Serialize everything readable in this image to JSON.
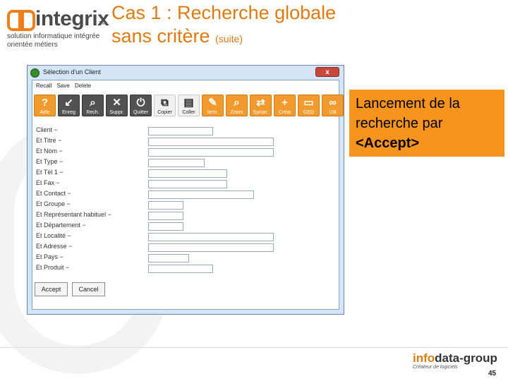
{
  "logo": {
    "word": "integrix",
    "tm": "TM",
    "tagline_1": "solution informatique intégrée",
    "tagline_2": "orientée métiers"
  },
  "slide": {
    "title_line1": "Cas 1 : Recherche globale",
    "title_line2": "sans critère",
    "title_suffix": "(suite)",
    "callout": {
      "line1": "Lancement de la",
      "line2": "recherche par",
      "line3": "<Accept>",
      "color": "#f7941d"
    },
    "page_number": "45",
    "brand": {
      "prefix": "info",
      "name": "data-group",
      "tagline": "Créateur de logiciels"
    }
  },
  "window": {
    "title": "Sélection d'un Client",
    "close": "x",
    "menu": [
      "Recall",
      "Save",
      "Delete"
    ],
    "toolbar": [
      {
        "label": "Aide",
        "glyph": "?",
        "style": "orange"
      },
      {
        "label": "Enreg",
        "glyph": "↙",
        "style": "dark"
      },
      {
        "label": "Rech.",
        "glyph": "⌕",
        "style": "dark"
      },
      {
        "label": "Suppr.",
        "glyph": "✕",
        "style": "dark"
      },
      {
        "label": "Quitter",
        "glyph": "⏻",
        "style": "dark"
      },
      {
        "label": "Copier",
        "glyph": "⧉",
        "style": "plain"
      },
      {
        "label": "Coller",
        "glyph": "▤",
        "style": "plain"
      },
      {
        "label": "Item.",
        "glyph": "✎",
        "style": "orange"
      },
      {
        "label": "Zoom",
        "glyph": "⌕",
        "style": "orange"
      },
      {
        "label": "Synon.",
        "glyph": "⇄",
        "style": "orange"
      },
      {
        "label": "Créat",
        "glyph": "+",
        "style": "orange"
      },
      {
        "label": "GED",
        "glyph": "▭",
        "style": "orange"
      },
      {
        "label": "Util",
        "glyph": "∞",
        "style": "orange"
      }
    ],
    "fields": [
      {
        "label": "Client −"
      },
      {
        "label": "Et Titre −"
      },
      {
        "label": "Et Nom −"
      },
      {
        "label": "Et Type −"
      },
      {
        "label": "Et Tél 1 −"
      },
      {
        "label": "Et Fax −"
      },
      {
        "label": "Et Contact −"
      },
      {
        "label": "Et Groupe −"
      },
      {
        "label": "Et Représentant habituel −"
      },
      {
        "label": "Et Département −"
      },
      {
        "label": "Et Localité −"
      },
      {
        "label": "Et Adresse −"
      },
      {
        "label": "Et Pays −"
      },
      {
        "label": "Et Produit −"
      }
    ],
    "buttons": {
      "accept": "Accept",
      "cancel": "Cancel"
    }
  }
}
